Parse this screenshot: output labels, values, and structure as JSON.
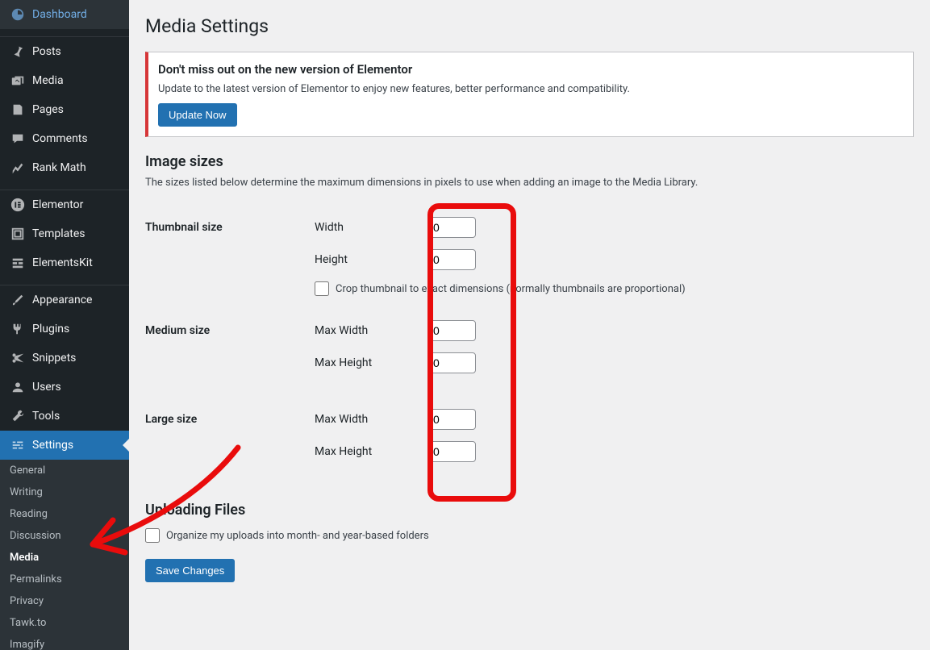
{
  "sidebar": {
    "items": [
      {
        "label": "Dashboard",
        "icon": "dashboard"
      },
      {
        "label": "Posts",
        "icon": "pin"
      },
      {
        "label": "Media",
        "icon": "media"
      },
      {
        "label": "Pages",
        "icon": "pages"
      },
      {
        "label": "Comments",
        "icon": "comments"
      },
      {
        "label": "Rank Math",
        "icon": "chart"
      },
      {
        "label": "Elementor",
        "icon": "elementor"
      },
      {
        "label": "Templates",
        "icon": "templates"
      },
      {
        "label": "ElementsKit",
        "icon": "ekit"
      },
      {
        "label": "Appearance",
        "icon": "brush"
      },
      {
        "label": "Plugins",
        "icon": "plug"
      },
      {
        "label": "Snippets",
        "icon": "scissors"
      },
      {
        "label": "Users",
        "icon": "users"
      },
      {
        "label": "Tools",
        "icon": "wrench"
      },
      {
        "label": "Settings",
        "icon": "sliders"
      }
    ],
    "settings_submenu": [
      "General",
      "Writing",
      "Reading",
      "Discussion",
      "Media",
      "Permalinks",
      "Privacy",
      "Tawk.to",
      "Imagify"
    ],
    "settings_current": "Media"
  },
  "page": {
    "title": "Media Settings"
  },
  "notice": {
    "headline": "Don't miss out on the new version of Elementor",
    "body": "Update to the latest version of Elementor to enjoy new features, better performance and compatibility.",
    "button": "Update Now"
  },
  "section_image_sizes": {
    "heading": "Image sizes",
    "description": "The sizes listed below determine the maximum dimensions in pixels to use when adding an image to the Media Library."
  },
  "thumbnail": {
    "label": "Thumbnail size",
    "width_label": "Width",
    "width_value": "0",
    "height_label": "Height",
    "height_value": "0",
    "crop_label": "Crop thumbnail to exact dimensions (normally thumbnails are proportional)"
  },
  "medium": {
    "label": "Medium size",
    "maxwidth_label": "Max Width",
    "maxwidth_value": "0",
    "maxheight_label": "Max Height",
    "maxheight_value": "0"
  },
  "large": {
    "label": "Large size",
    "maxwidth_label": "Max Width",
    "maxwidth_value": "0",
    "maxheight_label": "Max Height",
    "maxheight_value": "0"
  },
  "uploading": {
    "heading": "Uploading Files",
    "checkbox_label": "Organize my uploads into month- and year-based folders"
  },
  "save_button": "Save Changes",
  "icons": {
    "dashboard": "◉",
    "pin": "📌",
    "media": "🎵",
    "pages": "▤",
    "comments": "💬",
    "chart": "📈",
    "elementor": "ⓔ",
    "templates": "▣",
    "ekit": "⧉",
    "brush": "🖌",
    "plug": "🔌",
    "scissors": "✂",
    "users": "👤",
    "wrench": "🔧",
    "sliders": "⚙"
  }
}
